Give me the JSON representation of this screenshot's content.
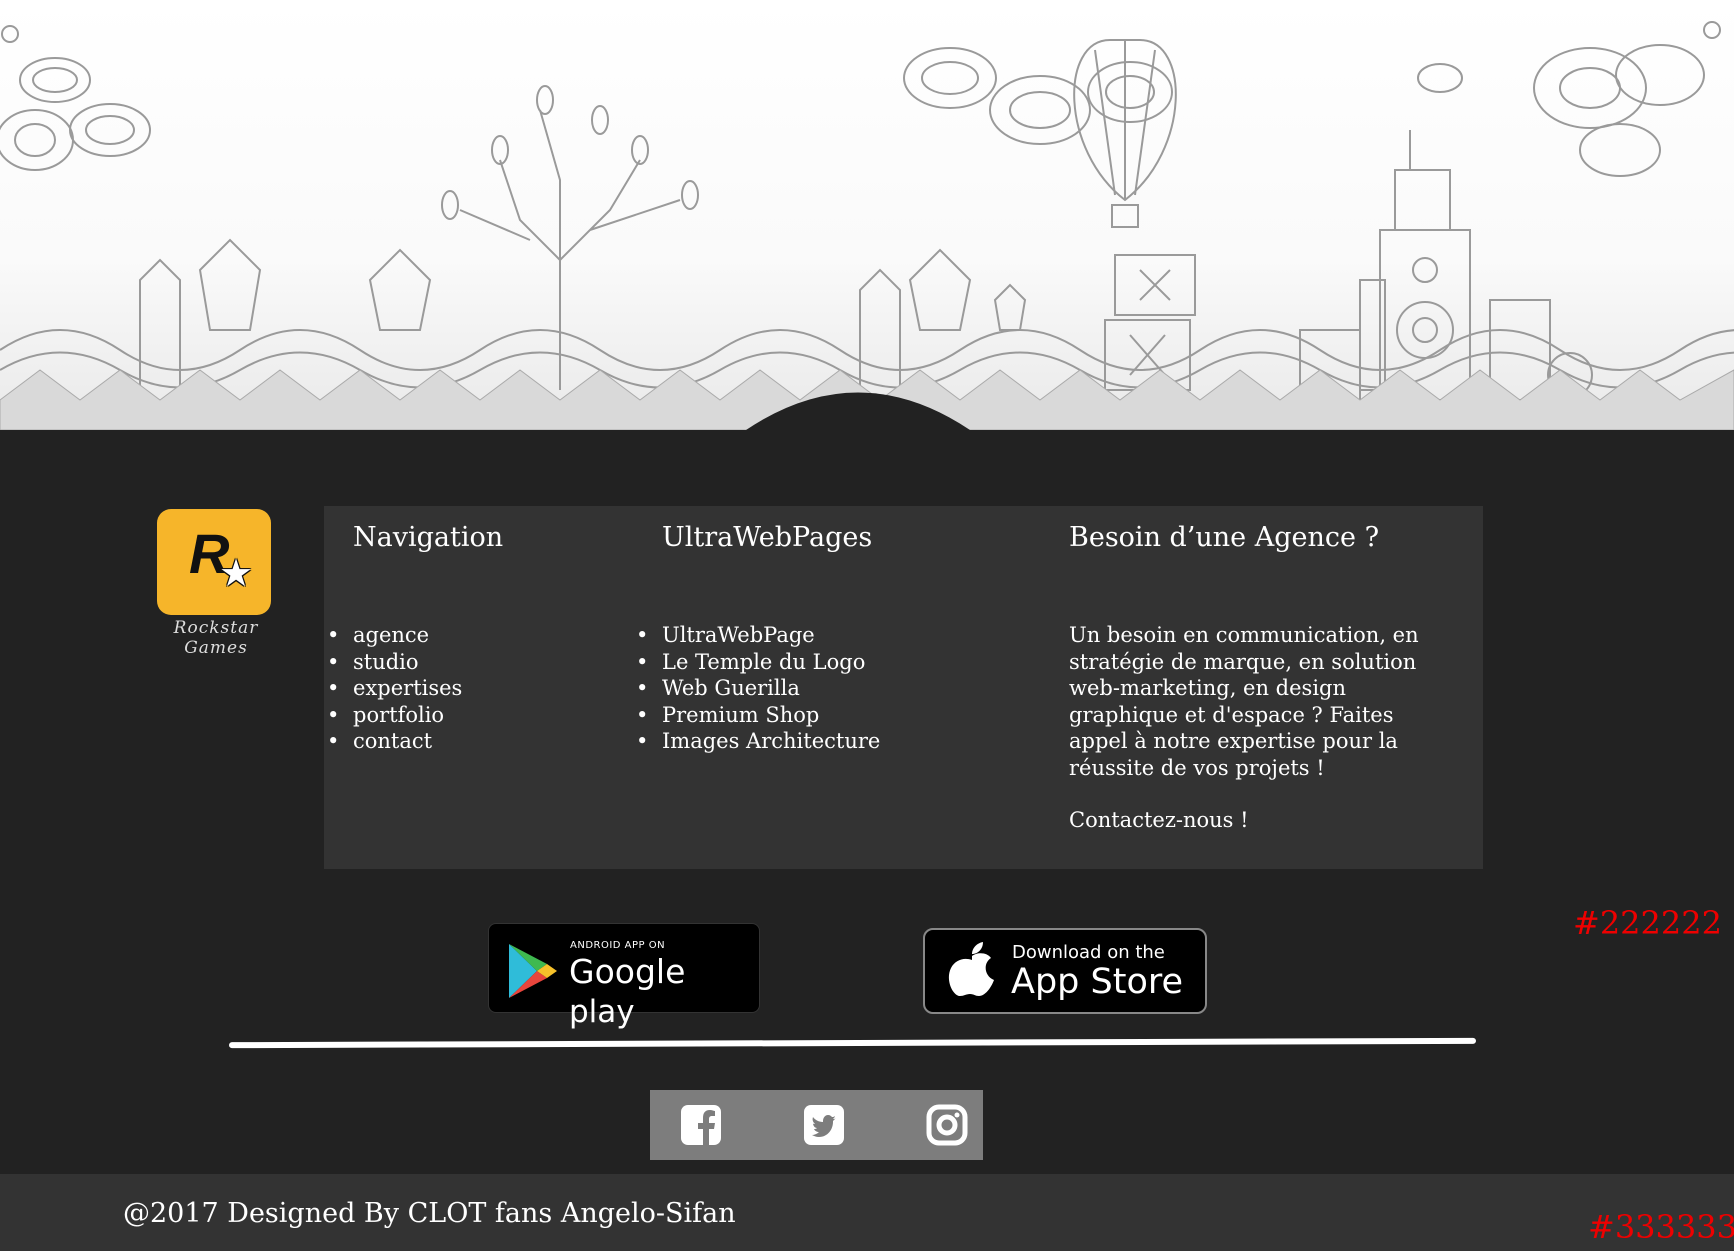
{
  "colors": {
    "dark_bg": "#222222",
    "panel_bg": "#333333",
    "annotation": "#ee0000",
    "logo_bg": "#f6b52a"
  },
  "hero": {
    "icon": "doodle-city-illustration"
  },
  "logo": {
    "caption": "Rockstar Games",
    "icon": "rockstar-logo-icon",
    "letter": "R"
  },
  "nav": {
    "title": "Navigation",
    "items": [
      "agence",
      "studio",
      "expertises",
      "portfolio",
      "contact"
    ]
  },
  "ultra": {
    "title": "UltraWebPages",
    "items": [
      "UltraWebPage",
      "Le Temple du Logo",
      "Web Guerilla",
      "Premium Shop",
      "Images Architecture"
    ]
  },
  "agency": {
    "title": "Besoin d’une Agence ?",
    "text": "Un besoin en communication, en stratégie de marque, en solution web-marketing, en design graphique et d'espace ? Faites appel à notre expertise pour la réussite de vos projets !",
    "contact": "Contactez-nous !"
  },
  "badges": {
    "google_small": "ANDROID APP ON",
    "google_big": "Google",
    "google_play": "play",
    "apple_small": "Download on the",
    "apple_big": "App Store"
  },
  "social": [
    "facebook-icon",
    "twitter-icon",
    "instagram-icon"
  ],
  "footer": {
    "copyright": "@2017 Designed By CLOT fans Angelo-Sifan"
  },
  "annotations": {
    "dark": "#222222",
    "footer": "#333333"
  }
}
